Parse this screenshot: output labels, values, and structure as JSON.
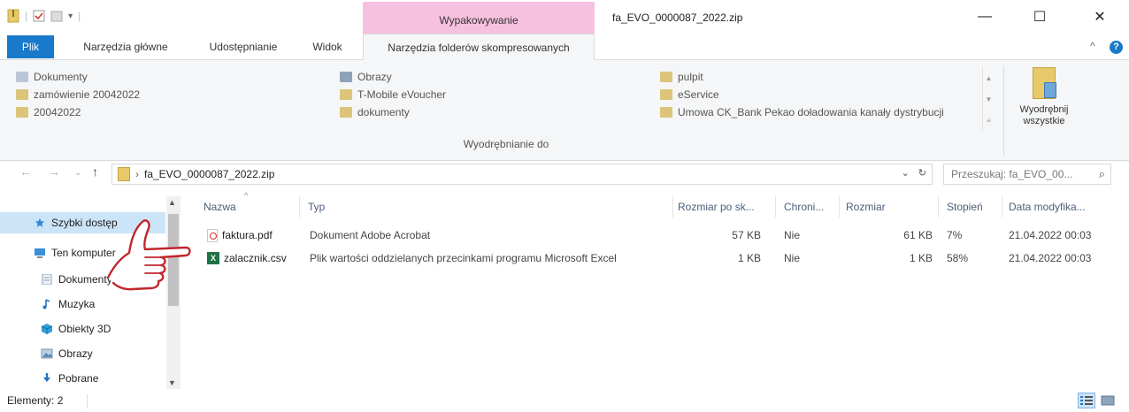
{
  "window": {
    "title": "fa_EVO_0000087_2022.zip",
    "context_tab_header": "Wypakowywanie",
    "minimize": "—",
    "maximize": "☐",
    "close": "✕"
  },
  "tabs": {
    "file": "Plik",
    "home": "Narzędzia główne",
    "share": "Udostępnianie",
    "view": "Widok",
    "compressed_tools": "Narzędzia folderów skompresowanych"
  },
  "ribbon": {
    "destinations": [
      "Dokumenty",
      "zamówienie 20042022",
      "20042022",
      "Obrazy",
      "T-Mobile eVoucher",
      "dokumenty",
      "pulpit",
      "eService",
      "Umowa CK_Bank Pekao doładowania kanały dystrybucji"
    ],
    "group_label": "Wyodrębnianie do",
    "extract_all_line1": "Wyodrębnij",
    "extract_all_line2": "wszystkie"
  },
  "address": {
    "path": "fa_EVO_0000087_2022.zip",
    "search_placeholder": "Przeszukaj: fa_EVO_00..."
  },
  "nav_pane": {
    "items": [
      "Szybki dostęp",
      "Ten komputer",
      "Dokumenty",
      "Muzyka",
      "Obiekty 3D",
      "Obrazy",
      "Pobrane"
    ]
  },
  "columns": [
    "Nazwa",
    "Typ",
    "Rozmiar po sk...",
    "Chroni...",
    "Rozmiar",
    "Stopień",
    "Data modyfika..."
  ],
  "files": [
    {
      "name": "faktura.pdf",
      "type": "Dokument Adobe Acrobat",
      "packed": "57 KB",
      "protected": "Nie",
      "size": "61 KB",
      "ratio": "7%",
      "modified": "21.04.2022 00:03"
    },
    {
      "name": "zalacznik.csv",
      "type": "Plik wartości oddzielanych przecinkami programu Microsoft Excel",
      "packed": "1 KB",
      "protected": "Nie",
      "size": "1 KB",
      "ratio": "58%",
      "modified": "21.04.2022 00:03"
    }
  ],
  "status": {
    "items_count": "Elementy: 2"
  },
  "colors": {
    "accent": "#1979ca",
    "context_tab": "#f6c1df",
    "annotation": "#c0272d",
    "selection": "#cce4f7"
  }
}
